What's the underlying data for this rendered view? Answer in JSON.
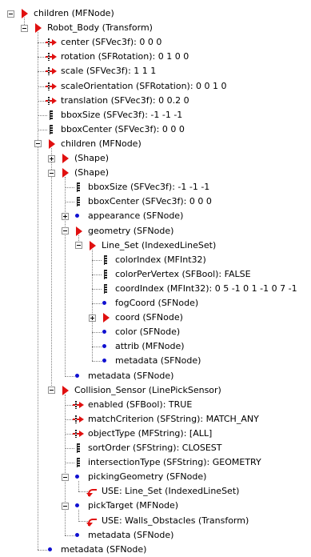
{
  "tree": [
    {
      "label": "children (MFNode)",
      "icon": "node",
      "expanded": true
    },
    {
      "label": "Robot_Body (Transform)",
      "icon": "node",
      "expanded": true
    },
    {
      "label": "center (SFVec3f): 0  0  0",
      "icon": "field-arrow"
    },
    {
      "label": "rotation (SFRotation): 0  1  0  0",
      "icon": "field-arrow"
    },
    {
      "label": "scale (SFVec3f): 1  1  1",
      "icon": "field-arrow"
    },
    {
      "label": "scaleOrientation (SFRotation): 0  0  1  0",
      "icon": "field-arrow"
    },
    {
      "label": "translation (SFVec3f): 0        0.2        0",
      "icon": "field-arrow"
    },
    {
      "label": "bboxSize (SFVec3f): -1 -1 -1",
      "icon": "field"
    },
    {
      "label": "bboxCenter (SFVec3f): 0  0  0",
      "icon": "field"
    },
    {
      "label": "children (MFNode)",
      "icon": "node",
      "expanded": true
    },
    {
      "label": "(Shape)",
      "icon": "node",
      "expanded": false
    },
    {
      "label": "(Shape)",
      "icon": "node",
      "expanded": true
    },
    {
      "label": "bboxSize (SFVec3f): -1 -1 -1",
      "icon": "field"
    },
    {
      "label": "bboxCenter (SFVec3f): 0  0  0",
      "icon": "field"
    },
    {
      "label": "appearance (SFNode)",
      "icon": "dot",
      "expanded": false
    },
    {
      "label": "geometry (SFNode)",
      "icon": "node",
      "expanded": true
    },
    {
      "label": "Line_Set (IndexedLineSet)",
      "icon": "node",
      "expanded": true
    },
    {
      "label": "colorIndex (MFInt32)",
      "icon": "field"
    },
    {
      "label": "colorPerVertex (SFBool): FALSE",
      "icon": "field"
    },
    {
      "label": "coordIndex (MFInt32): 0 5 -1 0 1 -1 0 7 -1",
      "icon": "field"
    },
    {
      "label": "fogCoord (SFNode)",
      "icon": "dot"
    },
    {
      "label": "coord (SFNode)",
      "icon": "node",
      "expanded": false
    },
    {
      "label": "color (SFNode)",
      "icon": "dot"
    },
    {
      "label": "attrib (MFNode)",
      "icon": "dot"
    },
    {
      "label": "metadata (SFNode)",
      "icon": "dot"
    },
    {
      "label": "metadata (SFNode)",
      "icon": "dot"
    },
    {
      "label": "Collision_Sensor (LinePickSensor)",
      "icon": "node",
      "expanded": true
    },
    {
      "label": "enabled (SFBool): TRUE",
      "icon": "field-arrow"
    },
    {
      "label": "matchCriterion (SFString): MATCH_ANY",
      "icon": "field-arrow"
    },
    {
      "label": "objectType (MFString): [ALL]",
      "icon": "field-arrow"
    },
    {
      "label": "sortOrder (SFString): CLOSEST",
      "icon": "field"
    },
    {
      "label": "intersectionType (SFString): GEOMETRY",
      "icon": "field"
    },
    {
      "label": "pickingGeometry (SFNode)",
      "icon": "dot",
      "expanded": true
    },
    {
      "label": "USE: Line_Set (IndexedLineSet)",
      "icon": "use"
    },
    {
      "label": "pickTarget (MFNode)",
      "icon": "dot",
      "expanded": true
    },
    {
      "label": "USE: Walls_Obstacles (Transform)",
      "icon": "use"
    },
    {
      "label": "metadata (SFNode)",
      "icon": "dot"
    },
    {
      "label": "metadata (SFNode)",
      "icon": "dot"
    }
  ]
}
